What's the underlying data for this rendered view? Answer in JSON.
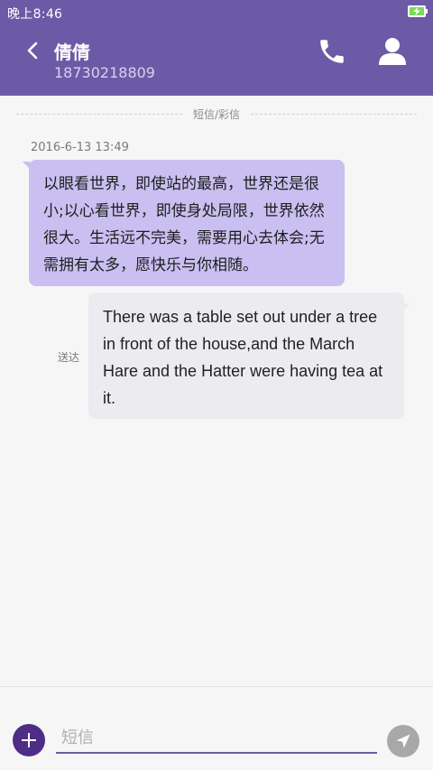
{
  "status_bar": {
    "time": "晚上8:46",
    "battery_icon": "battery-charging-icon"
  },
  "header": {
    "back_icon": "chevron-left-icon",
    "contact_name": "倩倩",
    "contact_number": "18730218809",
    "call_icon": "phone-icon",
    "profile_icon": "person-icon"
  },
  "conversation": {
    "divider_label": "短信/彩信",
    "timestamp": "2016-6-13 13:49",
    "messages": [
      {
        "direction": "incoming",
        "text": "以眼看世界，即使站的最高，世界还是很小;以心看世界，即使身处局限，世界依然很大。生活远不完美，需要用心去体会;无需拥有太多，愿快乐与你相随。"
      },
      {
        "direction": "outgoing",
        "text": "There was a table set out under a tree in front of the house,and the March Hare and the Hatter were having tea at it.",
        "status": "送达"
      }
    ]
  },
  "composer": {
    "add_icon": "plus-icon",
    "placeholder": "短信",
    "send_icon": "send-icon"
  },
  "colors": {
    "header": "#6c5aa6",
    "incoming_bubble": "#c9bff0",
    "outgoing_bubble": "#ecebef",
    "add_button": "#4d2d85",
    "send_button": "#a8a8a8"
  }
}
